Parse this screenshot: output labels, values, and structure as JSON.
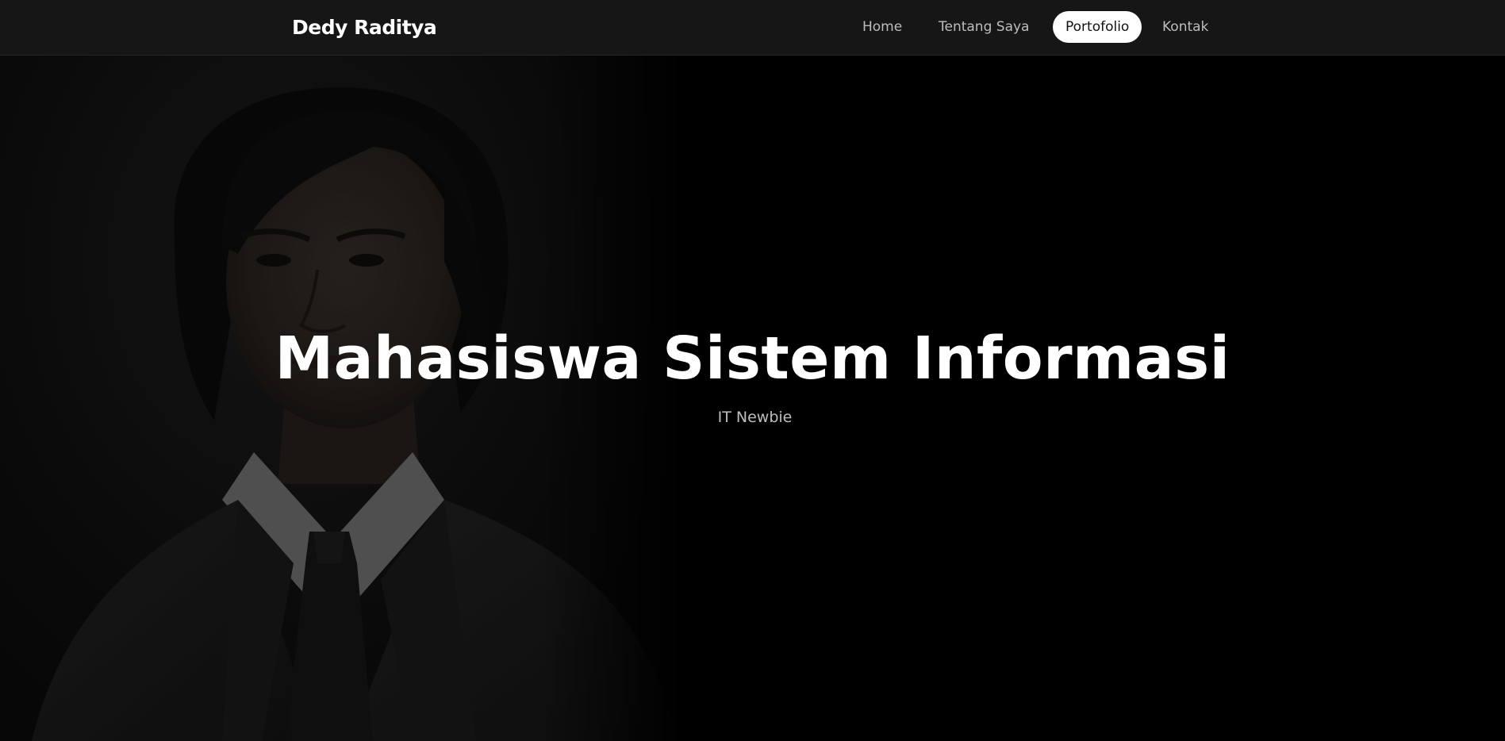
{
  "brand": {
    "name": "Dedy Raditya"
  },
  "nav": {
    "items": [
      {
        "label": "Home",
        "active": false
      },
      {
        "label": "Tentang Saya",
        "active": false
      },
      {
        "label": "Portofolio",
        "active": true
      },
      {
        "label": "Kontak",
        "active": false
      }
    ]
  },
  "hero": {
    "title": "Mahasiswa Sistem Informasi",
    "subtitle": "IT Newbie"
  },
  "colors": {
    "background": "#000000",
    "navbar": "#161616",
    "text": "#ffffff",
    "muted_text": "#bdbdbd",
    "active_pill": "#ffffff"
  }
}
